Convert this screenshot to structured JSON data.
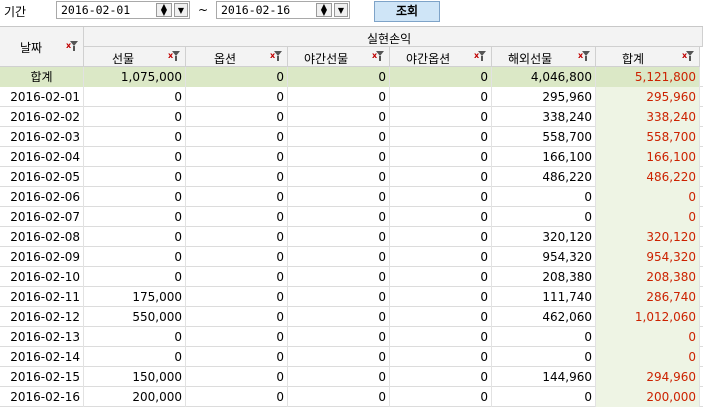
{
  "search": {
    "period_label": "기간",
    "start_date": "2016-02-01",
    "end_date": "2016-02-16",
    "separator": "~",
    "search_button_label": "조회"
  },
  "grid": {
    "group_header": "실현손익",
    "columns": {
      "date": "날짜",
      "futures": "선물",
      "options": "옵션",
      "night_futures": "야간선물",
      "night_options": "야간옵션",
      "overseas_futures": "해외선물",
      "total": "합계"
    },
    "summary": {
      "label": "합계",
      "futures": "1,075,000",
      "options": "0",
      "night_futures": "0",
      "night_options": "0",
      "overseas_futures": "4,046,800",
      "total": "5,121,800"
    },
    "rows": [
      {
        "date": "2016-02-01",
        "futures": "0",
        "options": "0",
        "night_futures": "0",
        "night_options": "0",
        "overseas_futures": "295,960",
        "total": "295,960"
      },
      {
        "date": "2016-02-02",
        "futures": "0",
        "options": "0",
        "night_futures": "0",
        "night_options": "0",
        "overseas_futures": "338,240",
        "total": "338,240"
      },
      {
        "date": "2016-02-03",
        "futures": "0",
        "options": "0",
        "night_futures": "0",
        "night_options": "0",
        "overseas_futures": "558,700",
        "total": "558,700"
      },
      {
        "date": "2016-02-04",
        "futures": "0",
        "options": "0",
        "night_futures": "0",
        "night_options": "0",
        "overseas_futures": "166,100",
        "total": "166,100"
      },
      {
        "date": "2016-02-05",
        "futures": "0",
        "options": "0",
        "night_futures": "0",
        "night_options": "0",
        "overseas_futures": "486,220",
        "total": "486,220"
      },
      {
        "date": "2016-02-06",
        "futures": "0",
        "options": "0",
        "night_futures": "0",
        "night_options": "0",
        "overseas_futures": "0",
        "total": "0"
      },
      {
        "date": "2016-02-07",
        "futures": "0",
        "options": "0",
        "night_futures": "0",
        "night_options": "0",
        "overseas_futures": "0",
        "total": "0"
      },
      {
        "date": "2016-02-08",
        "futures": "0",
        "options": "0",
        "night_futures": "0",
        "night_options": "0",
        "overseas_futures": "320,120",
        "total": "320,120"
      },
      {
        "date": "2016-02-09",
        "futures": "0",
        "options": "0",
        "night_futures": "0",
        "night_options": "0",
        "overseas_futures": "954,320",
        "total": "954,320"
      },
      {
        "date": "2016-02-10",
        "futures": "0",
        "options": "0",
        "night_futures": "0",
        "night_options": "0",
        "overseas_futures": "208,380",
        "total": "208,380"
      },
      {
        "date": "2016-02-11",
        "futures": "175,000",
        "options": "0",
        "night_futures": "0",
        "night_options": "0",
        "overseas_futures": "111,740",
        "total": "286,740"
      },
      {
        "date": "2016-02-12",
        "futures": "550,000",
        "options": "0",
        "night_futures": "0",
        "night_options": "0",
        "overseas_futures": "462,060",
        "total": "1,012,060"
      },
      {
        "date": "2016-02-13",
        "futures": "0",
        "options": "0",
        "night_futures": "0",
        "night_options": "0",
        "overseas_futures": "0",
        "total": "0"
      },
      {
        "date": "2016-02-14",
        "futures": "0",
        "options": "0",
        "night_futures": "0",
        "night_options": "0",
        "overseas_futures": "0",
        "total": "0"
      },
      {
        "date": "2016-02-15",
        "futures": "150,000",
        "options": "0",
        "night_futures": "0",
        "night_options": "0",
        "overseas_futures": "144,960",
        "total": "294,960"
      },
      {
        "date": "2016-02-16",
        "futures": "200,000",
        "options": "0",
        "night_futures": "0",
        "night_options": "0",
        "overseas_futures": "0",
        "total": "200,000"
      }
    ]
  },
  "colors": {
    "summary_row_bg": "#dbe8c6",
    "total_col_bg": "#eef4e4",
    "total_text": "#cc2200",
    "button_bg": "#cfe5f7"
  },
  "icons": {
    "spinner": "spin-up-down-icon",
    "dropdown": "chevron-down-icon",
    "filter": "column-filter-icon"
  }
}
